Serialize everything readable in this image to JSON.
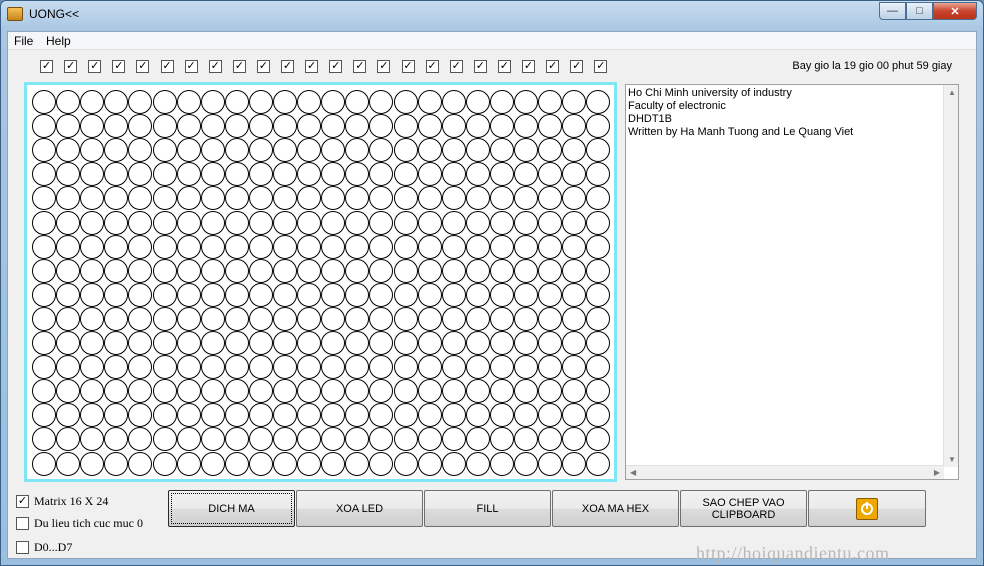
{
  "window": {
    "title": "UONG<<"
  },
  "menu": {
    "file": "File",
    "help": "Help"
  },
  "matrix": {
    "rows": 16,
    "cols": 24
  },
  "clock_text": "Bay gio la 19 gio 00 phut 59 giay",
  "info_lines": [
    "Ho Chi Minh university of industry",
    "Faculty of electronic",
    "DHDT1B",
    "Written by Ha Manh Tuong and Le Quang Viet"
  ],
  "options": {
    "matrix_size": {
      "label": "Matrix 16 X 24",
      "checked": true
    },
    "active_low": {
      "label": "Du lieu tich cuc muc 0",
      "checked": false
    },
    "d0_d7": {
      "label": "D0...D7",
      "checked": false
    }
  },
  "buttons": {
    "dich_ma": "DICH MA",
    "xoa_led": "XOA LED",
    "fill": "FILL",
    "xoa_ma_hex": "XOA MA HEX",
    "sao_chep": "SAO CHEP VAO CLIPBOARD"
  },
  "watermark": "http://hoiquandientu.com",
  "colors": {
    "matrix_border": "#7fe7f4",
    "power_button": "#f0a800"
  }
}
